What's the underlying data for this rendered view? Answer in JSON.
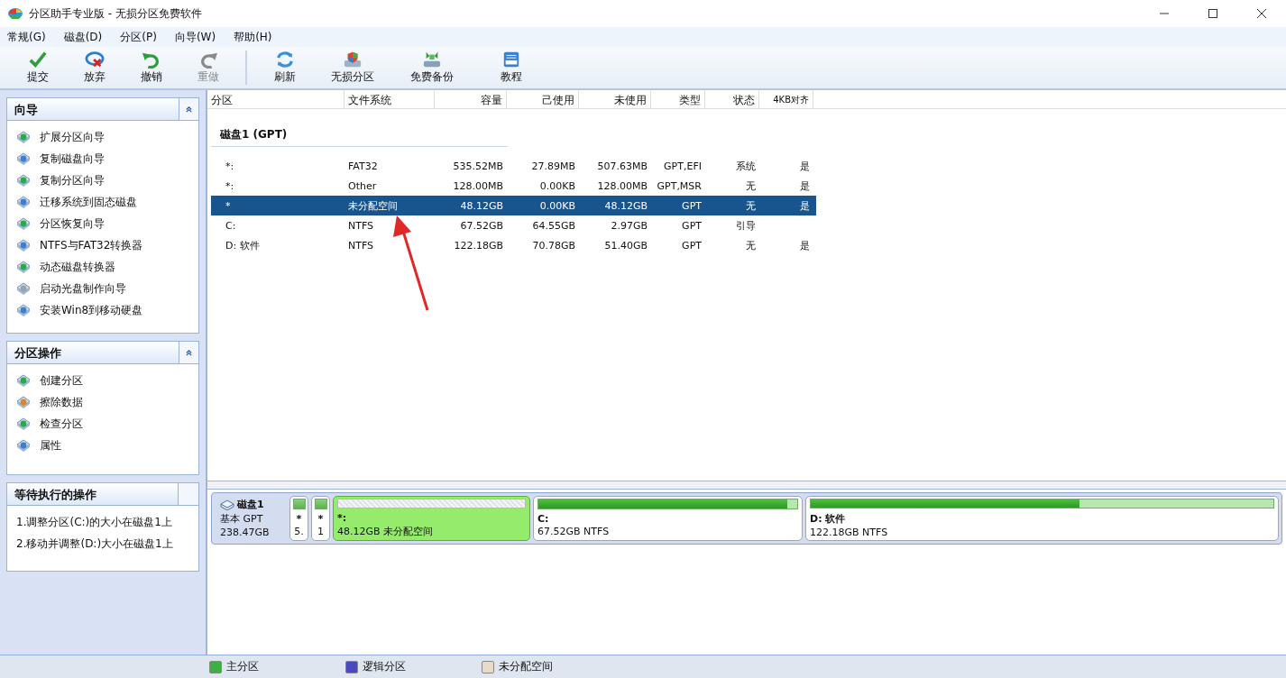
{
  "window": {
    "title": "分区助手专业版 - 无损分区免费软件"
  },
  "menu": [
    "常规(G)",
    "磁盘(D)",
    "分区(P)",
    "向导(W)",
    "帮助(H)"
  ],
  "toolbar": [
    {
      "label": "提交",
      "kind": "check",
      "disabled": false
    },
    {
      "label": "放弃",
      "kind": "discard",
      "disabled": false
    },
    {
      "label": "撤销",
      "kind": "undo",
      "disabled": false
    },
    {
      "label": "重做",
      "kind": "redo",
      "disabled": true
    },
    {
      "label": "刷新",
      "kind": "refresh",
      "disabled": false,
      "separator_before": true
    },
    {
      "label": "无损分区",
      "kind": "shield",
      "disabled": false
    },
    {
      "label": "免费备份",
      "kind": "backup",
      "disabled": false
    },
    {
      "label": "教程",
      "kind": "book",
      "disabled": false
    }
  ],
  "sidebar": [
    {
      "title": "向导",
      "collapsible": true,
      "kind": "links",
      "items": [
        {
          "label": "扩展分区向导",
          "color": "#2aa84a"
        },
        {
          "label": "复制磁盘向导",
          "color": "#3a7fd0"
        },
        {
          "label": "复制分区向导",
          "color": "#2aa84a"
        },
        {
          "label": "迁移系统到固态磁盘",
          "color": "#3a7fd0"
        },
        {
          "label": "分区恢复向导",
          "color": "#2aa84a"
        },
        {
          "label": "NTFS与FAT32转换器",
          "color": "#3a7fd0"
        },
        {
          "label": "动态磁盘转换器",
          "color": "#2aa84a"
        },
        {
          "label": "启动光盘制作向导",
          "color": "#9aa3ad"
        },
        {
          "label": "安装Win8到移动硬盘",
          "color": "#3a7fd0"
        }
      ]
    },
    {
      "title": "分区操作",
      "collapsible": true,
      "kind": "links",
      "items": [
        {
          "label": "创建分区",
          "color": "#2aa84a"
        },
        {
          "label": "擦除数据",
          "color": "#e0862a"
        },
        {
          "label": "检查分区",
          "color": "#2aa84a"
        },
        {
          "label": "属性",
          "color": "#3a7fd0"
        }
      ]
    },
    {
      "title": "等待执行的操作",
      "collapsible": false,
      "kind": "text",
      "items": [
        {
          "label": "1.调整分区(C:)的大小在磁盘1上"
        },
        {
          "label": "2.移动并调整(D:)大小在磁盘1上"
        }
      ]
    }
  ],
  "table": {
    "columns": [
      "分区",
      "文件系统",
      "容量",
      "己使用",
      "未使用",
      "类型",
      "状态",
      "4KB对齐"
    ],
    "disk_heading": "磁盘1 (GPT)",
    "rows": [
      {
        "cells": [
          "*:",
          "FAT32",
          "535.52MB",
          "27.89MB",
          "507.63MB",
          "GPT,EFI",
          "系统",
          "是"
        ],
        "selected": false
      },
      {
        "cells": [
          "*:",
          "Other",
          "128.00MB",
          "0.00KB",
          "128.00MB",
          "GPT,MSR",
          "无",
          "是"
        ],
        "selected": false
      },
      {
        "cells": [
          "*",
          "未分配空间",
          "48.12GB",
          "0.00KB",
          "48.12GB",
          "GPT",
          "无",
          "是"
        ],
        "selected": true
      },
      {
        "cells": [
          "C:",
          "NTFS",
          "67.52GB",
          "64.55GB",
          "2.97GB",
          "GPT",
          "引导",
          ""
        ],
        "selected": false
      },
      {
        "cells": [
          "D: 软件",
          "NTFS",
          "122.18GB",
          "70.78GB",
          "51.40GB",
          "GPT",
          "无",
          "是"
        ],
        "selected": false
      }
    ]
  },
  "disk_map": {
    "disk": {
      "name": "磁盘1",
      "type": "基本 GPT",
      "size": "238.47GB"
    },
    "partitions": [
      {
        "kind": "tiny",
        "label": "*",
        "detail": "5.",
        "selected": false
      },
      {
        "kind": "tiny",
        "label": "*",
        "detail": "1",
        "selected": false
      },
      {
        "kind": "unallocated",
        "label": "*:",
        "detail": "48.12GB 未分配空间",
        "selected": true
      },
      {
        "kind": "used",
        "label": "C:",
        "detail": "67.52GB NTFS",
        "selected": false,
        "level": 0.96
      },
      {
        "kind": "used",
        "label": "D: 软件",
        "detail": "122.18GB NTFS",
        "selected": false,
        "level": 0.58
      }
    ]
  },
  "legend": [
    {
      "label": "主分区",
      "color": "#3cb043"
    },
    {
      "label": "逻辑分区",
      "color": "#4a4ac0"
    },
    {
      "label": "未分配空间",
      "color": "#e8dcc8"
    }
  ]
}
